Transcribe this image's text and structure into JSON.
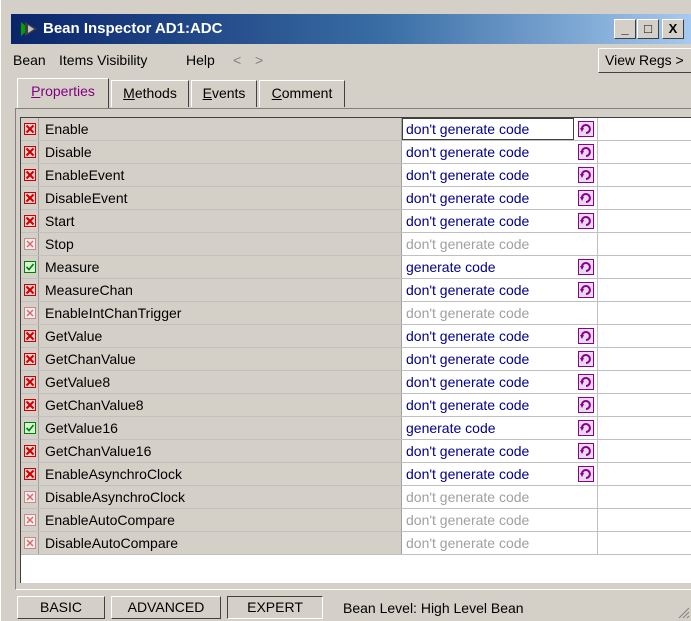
{
  "window": {
    "title": "Bean Inspector AD1:ADC",
    "minimize": "_",
    "maximize": "□",
    "close": "X"
  },
  "menu": {
    "items": [
      "Bean",
      "Items Visibility",
      "Help"
    ],
    "back_arrow": "<",
    "forward_arrow": ">",
    "view_regs": "View Regs >"
  },
  "tabs": [
    {
      "label": "Properties",
      "underline": "P",
      "rest": "roperties",
      "active": true
    },
    {
      "label": "Methods",
      "underline": "M",
      "rest": "ethods",
      "active": false
    },
    {
      "label": "Events",
      "underline": "E",
      "rest": "vents",
      "active": false
    },
    {
      "label": "Comment",
      "underline": "C",
      "rest": "omment",
      "active": false
    }
  ],
  "methods": [
    {
      "name": "Enable",
      "value": "don't generate code",
      "state": "disabled",
      "editable": true,
      "selected": true
    },
    {
      "name": "Disable",
      "value": "don't generate code",
      "state": "disabled",
      "editable": true
    },
    {
      "name": "EnableEvent",
      "value": "don't generate code",
      "state": "disabled",
      "editable": true
    },
    {
      "name": "DisableEvent",
      "value": "don't generate code",
      "state": "disabled",
      "editable": true
    },
    {
      "name": "Start",
      "value": "don't generate code",
      "state": "disabled",
      "editable": true
    },
    {
      "name": "Stop",
      "value": "don't generate code",
      "state": "unavailable",
      "editable": false
    },
    {
      "name": "Measure",
      "value": "generate code",
      "state": "enabled",
      "editable": true
    },
    {
      "name": "MeasureChan",
      "value": "don't generate code",
      "state": "disabled",
      "editable": true
    },
    {
      "name": "EnableIntChanTrigger",
      "value": "don't generate code",
      "state": "unavailable",
      "editable": false
    },
    {
      "name": "GetValue",
      "value": "don't generate code",
      "state": "disabled",
      "editable": true
    },
    {
      "name": "GetChanValue",
      "value": "don't generate code",
      "state": "disabled",
      "editable": true
    },
    {
      "name": "GetValue8",
      "value": "don't generate code",
      "state": "disabled",
      "editable": true
    },
    {
      "name": "GetChanValue8",
      "value": "don't generate code",
      "state": "disabled",
      "editable": true
    },
    {
      "name": "GetValue16",
      "value": "generate code",
      "state": "enabled",
      "editable": true
    },
    {
      "name": "GetChanValue16",
      "value": "don't generate code",
      "state": "disabled",
      "editable": true
    },
    {
      "name": "EnableAsynchroClock",
      "value": "don't generate code",
      "state": "disabled",
      "editable": true
    },
    {
      "name": "DisableAsynchroClock",
      "value": "don't generate code",
      "state": "unavailable",
      "editable": false
    },
    {
      "name": "EnableAutoCompare",
      "value": "don't generate code",
      "state": "unavailable",
      "editable": false
    },
    {
      "name": "DisableAutoCompare",
      "value": "don't generate code",
      "state": "unavailable",
      "editable": false
    }
  ],
  "status": {
    "levels": [
      "BASIC",
      "ADVANCED",
      "EXPERT"
    ],
    "active_level": "EXPERT",
    "text": "Bean Level: High Level Bean"
  },
  "colors": {
    "titlebar_start": "#0a246a",
    "titlebar_end": "#a6caf0",
    "active_value": "#00008b",
    "inactive_value": "#a0a0a0",
    "disabled_mark": "#cc0000",
    "enabled_mark": "#008000",
    "toggle_icon": "#8b008b"
  }
}
